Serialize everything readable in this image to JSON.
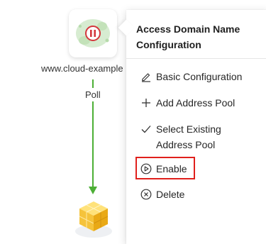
{
  "node": {
    "label": "www.cloud-example",
    "icon": "pause-icon",
    "status_color": "#d4373d"
  },
  "edge": {
    "label": "Poll",
    "color": "#4caf35"
  },
  "pool": {
    "icon": "address-pool-icon"
  },
  "menu": {
    "title": "Access Domain Name Configuration",
    "items": [
      {
        "label": "Basic Configuration",
        "icon": "edit-icon"
      },
      {
        "label": "Add Address Pool",
        "icon": "plus-icon"
      },
      {
        "label": "Select Existing Address Pool",
        "icon": "check-icon"
      },
      {
        "label": "Enable",
        "icon": "play-circle-icon"
      },
      {
        "label": "Delete",
        "icon": "close-circle-icon"
      }
    ],
    "highlight_color": "#e0201c"
  }
}
